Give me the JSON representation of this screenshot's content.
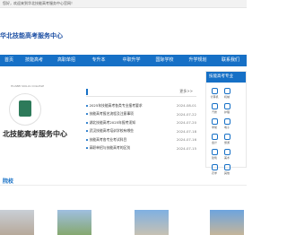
{
  "topbar": {
    "text": "您好，欢迎来到华北技能高考服务中心官网！"
  },
  "logo": {
    "text": "华北技能高考服务中心"
  },
  "nav": {
    "items": [
      "首页",
      "技能高考",
      "高职单招",
      "专升本",
      "中职升学",
      "国际学校",
      "升学规划",
      "联系我们"
    ]
  },
  "banner": {
    "caption": "北技能高考服务中心",
    "emblem_text": "HUABEI SKILLS COLLEGE"
  },
  "news": {
    "more": "更多>>",
    "items": [
      {
        "title": "2025年技能高考各类专业报考要求",
        "date": "2024-08-01"
      },
      {
        "title": "技能高考报名流程及注意事项",
        "date": "2024-07-22"
      },
      {
        "title": "湖北技能高考2025年报考须知",
        "date": "2024-07-20"
      },
      {
        "title": "武汉技能高考培训学校有哪些",
        "date": "2024-07-18"
      },
      {
        "title": "技能高考各专业考试科目",
        "date": "2024-07-16"
      },
      {
        "title": "高职单招与技能高考的区别",
        "date": "2024-07-15"
      }
    ]
  },
  "side_panel": {
    "title": "技能高考专业",
    "items": [
      "计算机",
      "机械",
      "汽修",
      "护理",
      "学前",
      "电子",
      "会计",
      "旅游",
      "建筑",
      "美术",
      "农学",
      "其他"
    ]
  },
  "section": {
    "title": "院校"
  }
}
